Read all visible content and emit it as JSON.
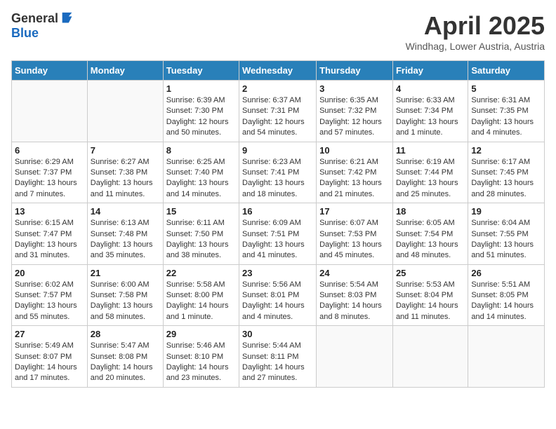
{
  "header": {
    "logo_general": "General",
    "logo_blue": "Blue",
    "title": "April 2025",
    "location": "Windhag, Lower Austria, Austria"
  },
  "weekdays": [
    "Sunday",
    "Monday",
    "Tuesday",
    "Wednesday",
    "Thursday",
    "Friday",
    "Saturday"
  ],
  "weeks": [
    [
      {
        "day": "",
        "info": ""
      },
      {
        "day": "",
        "info": ""
      },
      {
        "day": "1",
        "info": "Sunrise: 6:39 AM\nSunset: 7:30 PM\nDaylight: 12 hours\nand 50 minutes."
      },
      {
        "day": "2",
        "info": "Sunrise: 6:37 AM\nSunset: 7:31 PM\nDaylight: 12 hours\nand 54 minutes."
      },
      {
        "day": "3",
        "info": "Sunrise: 6:35 AM\nSunset: 7:32 PM\nDaylight: 12 hours\nand 57 minutes."
      },
      {
        "day": "4",
        "info": "Sunrise: 6:33 AM\nSunset: 7:34 PM\nDaylight: 13 hours\nand 1 minute."
      },
      {
        "day": "5",
        "info": "Sunrise: 6:31 AM\nSunset: 7:35 PM\nDaylight: 13 hours\nand 4 minutes."
      }
    ],
    [
      {
        "day": "6",
        "info": "Sunrise: 6:29 AM\nSunset: 7:37 PM\nDaylight: 13 hours\nand 7 minutes."
      },
      {
        "day": "7",
        "info": "Sunrise: 6:27 AM\nSunset: 7:38 PM\nDaylight: 13 hours\nand 11 minutes."
      },
      {
        "day": "8",
        "info": "Sunrise: 6:25 AM\nSunset: 7:40 PM\nDaylight: 13 hours\nand 14 minutes."
      },
      {
        "day": "9",
        "info": "Sunrise: 6:23 AM\nSunset: 7:41 PM\nDaylight: 13 hours\nand 18 minutes."
      },
      {
        "day": "10",
        "info": "Sunrise: 6:21 AM\nSunset: 7:42 PM\nDaylight: 13 hours\nand 21 minutes."
      },
      {
        "day": "11",
        "info": "Sunrise: 6:19 AM\nSunset: 7:44 PM\nDaylight: 13 hours\nand 25 minutes."
      },
      {
        "day": "12",
        "info": "Sunrise: 6:17 AM\nSunset: 7:45 PM\nDaylight: 13 hours\nand 28 minutes."
      }
    ],
    [
      {
        "day": "13",
        "info": "Sunrise: 6:15 AM\nSunset: 7:47 PM\nDaylight: 13 hours\nand 31 minutes."
      },
      {
        "day": "14",
        "info": "Sunrise: 6:13 AM\nSunset: 7:48 PM\nDaylight: 13 hours\nand 35 minutes."
      },
      {
        "day": "15",
        "info": "Sunrise: 6:11 AM\nSunset: 7:50 PM\nDaylight: 13 hours\nand 38 minutes."
      },
      {
        "day": "16",
        "info": "Sunrise: 6:09 AM\nSunset: 7:51 PM\nDaylight: 13 hours\nand 41 minutes."
      },
      {
        "day": "17",
        "info": "Sunrise: 6:07 AM\nSunset: 7:53 PM\nDaylight: 13 hours\nand 45 minutes."
      },
      {
        "day": "18",
        "info": "Sunrise: 6:05 AM\nSunset: 7:54 PM\nDaylight: 13 hours\nand 48 minutes."
      },
      {
        "day": "19",
        "info": "Sunrise: 6:04 AM\nSunset: 7:55 PM\nDaylight: 13 hours\nand 51 minutes."
      }
    ],
    [
      {
        "day": "20",
        "info": "Sunrise: 6:02 AM\nSunset: 7:57 PM\nDaylight: 13 hours\nand 55 minutes."
      },
      {
        "day": "21",
        "info": "Sunrise: 6:00 AM\nSunset: 7:58 PM\nDaylight: 13 hours\nand 58 minutes."
      },
      {
        "day": "22",
        "info": "Sunrise: 5:58 AM\nSunset: 8:00 PM\nDaylight: 14 hours\nand 1 minute."
      },
      {
        "day": "23",
        "info": "Sunrise: 5:56 AM\nSunset: 8:01 PM\nDaylight: 14 hours\nand 4 minutes."
      },
      {
        "day": "24",
        "info": "Sunrise: 5:54 AM\nSunset: 8:03 PM\nDaylight: 14 hours\nand 8 minutes."
      },
      {
        "day": "25",
        "info": "Sunrise: 5:53 AM\nSunset: 8:04 PM\nDaylight: 14 hours\nand 11 minutes."
      },
      {
        "day": "26",
        "info": "Sunrise: 5:51 AM\nSunset: 8:05 PM\nDaylight: 14 hours\nand 14 minutes."
      }
    ],
    [
      {
        "day": "27",
        "info": "Sunrise: 5:49 AM\nSunset: 8:07 PM\nDaylight: 14 hours\nand 17 minutes."
      },
      {
        "day": "28",
        "info": "Sunrise: 5:47 AM\nSunset: 8:08 PM\nDaylight: 14 hours\nand 20 minutes."
      },
      {
        "day": "29",
        "info": "Sunrise: 5:46 AM\nSunset: 8:10 PM\nDaylight: 14 hours\nand 23 minutes."
      },
      {
        "day": "30",
        "info": "Sunrise: 5:44 AM\nSunset: 8:11 PM\nDaylight: 14 hours\nand 27 minutes."
      },
      {
        "day": "",
        "info": ""
      },
      {
        "day": "",
        "info": ""
      },
      {
        "day": "",
        "info": ""
      }
    ]
  ]
}
